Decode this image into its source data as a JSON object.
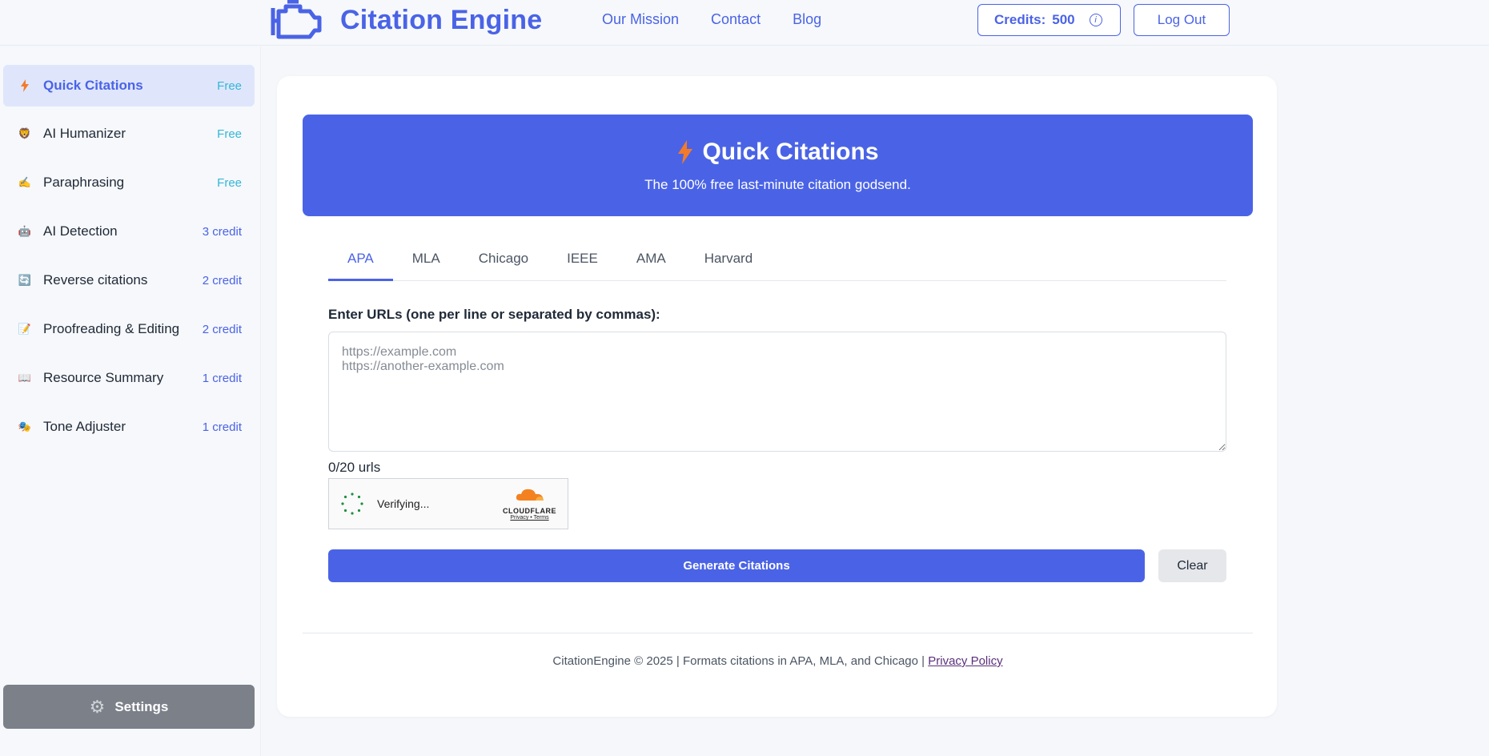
{
  "header": {
    "logo_text": "Citation Engine",
    "nav": [
      "Our Mission",
      "Contact",
      "Blog"
    ],
    "credits_label": "Credits:",
    "credits_value": "500",
    "logout_label": "Log Out"
  },
  "sidebar": {
    "items": [
      {
        "label": "Quick Citations",
        "badge": "Free",
        "icon": "⚡"
      },
      {
        "label": "AI Humanizer",
        "badge": "Free",
        "icon": "🦁"
      },
      {
        "label": "Paraphrasing",
        "badge": "Free",
        "icon": "✍️"
      },
      {
        "label": "AI Detection",
        "badge": "3 credit",
        "icon": "🤖"
      },
      {
        "label": "Reverse citations",
        "badge": "2 credit",
        "icon": "🔄"
      },
      {
        "label": "Proofreading & Editing",
        "badge": "2 credit",
        "icon": "📝"
      },
      {
        "label": "Resource Summary",
        "badge": "1 credit",
        "icon": "📖"
      },
      {
        "label": "Tone Adjuster",
        "badge": "1 credit",
        "icon": "🎭"
      }
    ],
    "settings_label": "Settings"
  },
  "hero": {
    "title": "Quick Citations",
    "subtitle": "The 100% free last-minute citation godsend."
  },
  "tabs": [
    "APA",
    "MLA",
    "Chicago",
    "IEEE",
    "AMA",
    "Harvard"
  ],
  "form": {
    "url_label": "Enter URLs (one per line or separated by commas):",
    "url_placeholder": "https://example.com\nhttps://another-example.com",
    "url_count": "0/20 urls",
    "captcha_text": "Verifying...",
    "captcha_brand": "CLOUDFLARE",
    "captcha_links": "Privacy • Terms",
    "generate_label": "Generate Citations",
    "clear_label": "Clear"
  },
  "footer": {
    "text": "CitationEngine © 2025 | Formats citations in APA, MLA, and Chicago |",
    "privacy_label": "Privacy Policy"
  },
  "colors": {
    "accent": "#4a63e6",
    "free_badge": "#35b6d6",
    "settings_bg": "#7b8089"
  }
}
